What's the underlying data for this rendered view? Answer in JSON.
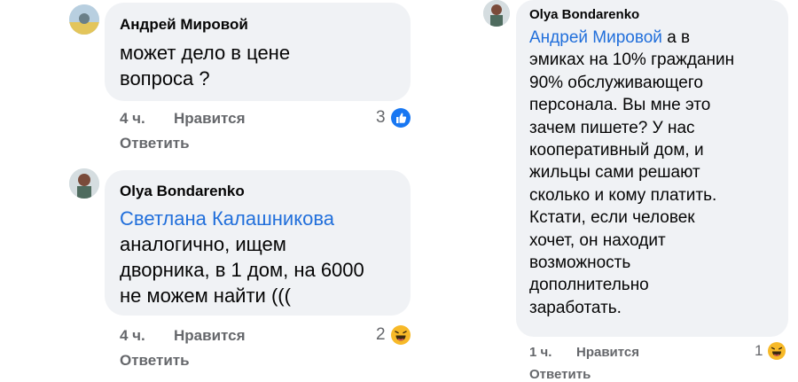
{
  "comments": [
    {
      "author": "Андрей Мировой",
      "text_lines": [
        "может дело в цене",
        "вопроса ?"
      ],
      "time": "4 ч.",
      "like_label": "Нравится",
      "reply_label": "Ответить",
      "reaction_count": "3",
      "reaction_icon": "like-icon"
    },
    {
      "author": "Olya Bondarenko",
      "mention": "Светлана Калашникова",
      "text_lines": [
        "аналогично, ищем",
        "дворника, в 1 дом, на 6000",
        "не можем найти ((("
      ],
      "time": "4 ч.",
      "like_label": "Нравится",
      "reply_label": "Ответить",
      "reaction_count": "2",
      "reaction_icon": "haha-icon"
    },
    {
      "author": "Olya Bondarenko",
      "mention": "Андрей Мировой",
      "first_line_rest": " а в",
      "text_lines": [
        "эмиках на 10% гражданин",
        "90% обслуживающего",
        "персонала. Вы мне это",
        "зачем пишете? У нас",
        "кооперативный дом, и",
        "жильцы сами решают",
        "сколько и кому платить.",
        "Кстати, если человек",
        "хочет, он находит",
        "возможность",
        "дополнительно",
        "заработать."
      ],
      "time": "1 ч.",
      "like_label": "Нравится",
      "reply_label": "Ответить",
      "reaction_count": "1",
      "reaction_icon": "haha-icon"
    }
  ],
  "colors": {
    "bubble": "#f0f2f5",
    "mention": "#216fdb",
    "meta": "#65676b",
    "like_blue": "#1877f2",
    "haha_yellow": "#f7b928"
  }
}
